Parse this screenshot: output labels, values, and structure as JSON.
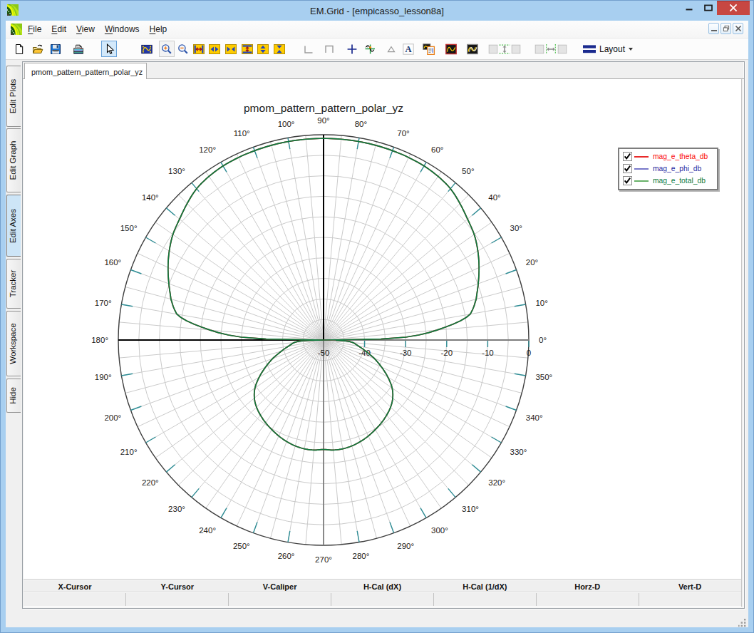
{
  "window": {
    "title": "EM.Grid - [empicasso_lesson8a]",
    "controls": [
      {
        "name": "minimize",
        "glyph": "minimize-icon"
      },
      {
        "name": "maximize",
        "glyph": "maximize-icon"
      },
      {
        "name": "close",
        "glyph": "close-icon"
      }
    ],
    "border_color": "#a8cff0",
    "close_color": "#c74742"
  },
  "menu": {
    "items": [
      {
        "label": "File",
        "mnemonic": "F"
      },
      {
        "label": "Edit",
        "mnemonic": "E"
      },
      {
        "label": "View",
        "mnemonic": "V"
      },
      {
        "label": "Windows",
        "mnemonic": "W"
      },
      {
        "label": "Help",
        "mnemonic": "H"
      }
    ],
    "mdi_controls": [
      "minimize",
      "restore",
      "close"
    ]
  },
  "toolbar": {
    "buttons": [
      {
        "icon": "new-document",
        "state": "normal"
      },
      {
        "icon": "open-file",
        "state": "normal"
      },
      {
        "icon": "save-file",
        "state": "normal"
      },
      {
        "icon": "print",
        "state": "normal"
      },
      {
        "icon": "pointer",
        "state": "selected"
      },
      {
        "icon": "fit-plot",
        "state": "normal"
      },
      {
        "icon": "zoom-in",
        "state": "raised"
      },
      {
        "icon": "zoom-out",
        "state": "normal"
      },
      {
        "icon": "expand-x",
        "state": "normal"
      },
      {
        "icon": "widen-x",
        "state": "normal"
      },
      {
        "icon": "narrow-x",
        "state": "normal"
      },
      {
        "icon": "expand-y",
        "state": "normal"
      },
      {
        "icon": "widen-y",
        "state": "normal"
      },
      {
        "icon": "narrow-y",
        "state": "normal"
      },
      {
        "icon": "axes-corner",
        "state": "disabled"
      },
      {
        "icon": "axes-box",
        "state": "disabled"
      },
      {
        "icon": "crosshair",
        "state": "normal"
      },
      {
        "icon": "tracker-cross",
        "state": "normal"
      },
      {
        "icon": "marker-triangle",
        "state": "disabled"
      },
      {
        "icon": "text-label",
        "state": "normal"
      },
      {
        "icon": "copy-graph",
        "state": "normal"
      },
      {
        "icon": "plot-single",
        "state": "normal"
      },
      {
        "icon": "plot-multi",
        "state": "normal"
      },
      {
        "icon": "blank-box-1",
        "state": "disabled"
      },
      {
        "icon": "equalize-vertical",
        "state": "disabled"
      },
      {
        "icon": "blank-box-2",
        "state": "disabled"
      },
      {
        "icon": "blank-box-3",
        "state": "disabled"
      },
      {
        "icon": "equalize-horizontal",
        "state": "disabled"
      },
      {
        "icon": "blank-box-4",
        "state": "disabled"
      }
    ],
    "layout_button": {
      "label": "Layout",
      "icon": "layout-bars-icon",
      "dropdown": true
    }
  },
  "side_tabs": {
    "items": [
      {
        "label": "Edit Plots",
        "selected": false
      },
      {
        "label": "Edit Graph",
        "selected": false
      },
      {
        "label": "Edit Axes",
        "selected": true
      },
      {
        "label": "Tracker",
        "selected": false
      },
      {
        "label": "Workspace",
        "selected": false
      },
      {
        "label": "Hide",
        "selected": false
      }
    ]
  },
  "doc_tab": {
    "label": "pmom_pattern_pattern_polar_yz",
    "selected": true
  },
  "tracker_bar": {
    "columns": [
      "X-Cursor",
      "Y-Cursor",
      "V-Caliper",
      "H-Cal (dX)",
      "H-Cal (1/dX)",
      "Horz-D",
      "Vert-D"
    ],
    "values": [
      "",
      "",
      "",
      "",
      "",
      "",
      ""
    ]
  },
  "chart_data": {
    "type": "line",
    "subtype": "polar",
    "title": "pmom_pattern_pattern_polar_yz",
    "angle_unit": "degrees",
    "angle_labels": [
      "0°",
      "10°",
      "20°",
      "30°",
      "40°",
      "50°",
      "60°",
      "70°",
      "80°",
      "90°",
      "100°",
      "110°",
      "120°",
      "130°",
      "140°",
      "150°",
      "160°",
      "170°",
      "180°",
      "190°",
      "200°",
      "210°",
      "220°",
      "230°",
      "240°",
      "250°",
      "260°",
      "270°",
      "280°",
      "290°",
      "300°",
      "310°",
      "320°",
      "330°",
      "340°",
      "350°"
    ],
    "angle_label_step_deg": 10,
    "spoke_step_deg": 5,
    "radial_axis": {
      "label_values": [
        -50,
        -40,
        -30,
        -20,
        -10,
        0
      ],
      "tick_labels": [
        "-50",
        "-40",
        "-30",
        "-20",
        "-10",
        "0"
      ],
      "min": -50,
      "max": 0,
      "ring_step_db": 5,
      "units": "dB"
    },
    "legend": {
      "position": "right",
      "entries": [
        {
          "label": "mag_e_theta_db",
          "color": "#e82a2a",
          "text_color": "#fb0a0a",
          "checked": true
        },
        {
          "label": "mag_e_phi_db",
          "color": "#7878c8",
          "text_color": "#2a2aa0",
          "checked": true
        },
        {
          "label": "mag_e_total_db",
          "color": "#67b168",
          "text_color": "#0e7a3e",
          "checked": true
        }
      ]
    },
    "series": [
      {
        "name": "mag_e_theta_db",
        "color": "#b22222",
        "points_deg_db": [
          [
            0,
            -50
          ],
          [
            1,
            -36
          ],
          [
            2,
            -30
          ],
          [
            3,
            -26.8
          ],
          [
            4,
            -24.3
          ],
          [
            5,
            -22.3
          ],
          [
            6,
            -20.2
          ],
          [
            7,
            -18.2
          ],
          [
            8,
            -16.3
          ],
          [
            9,
            -14.8
          ],
          [
            10,
            -13.7
          ],
          [
            12.5,
            -12.5
          ],
          [
            15,
            -11.5
          ],
          [
            20,
            -9.9
          ],
          [
            25,
            -8.2
          ],
          [
            30,
            -6.6
          ],
          [
            35,
            -5.2
          ],
          [
            40,
            -4.2
          ],
          [
            45,
            -3.0
          ],
          [
            50,
            -1.9
          ],
          [
            55,
            -1.35
          ],
          [
            60,
            -1.05
          ],
          [
            65,
            -0.95
          ],
          [
            70,
            -0.92
          ],
          [
            75,
            -0.9
          ],
          [
            80,
            -0.9
          ],
          [
            85,
            -0.9
          ],
          [
            90,
            -0.9
          ],
          [
            95,
            -0.9
          ],
          [
            100,
            -0.9
          ],
          [
            105,
            -0.9
          ],
          [
            110,
            -0.92
          ],
          [
            115,
            -0.95
          ],
          [
            120,
            -1.05
          ],
          [
            125,
            -1.35
          ],
          [
            130,
            -1.9
          ],
          [
            135,
            -3.0
          ],
          [
            140,
            -4.2
          ],
          [
            145,
            -5.2
          ],
          [
            150,
            -6.6
          ],
          [
            155,
            -8.2
          ],
          [
            160,
            -9.9
          ],
          [
            165,
            -11.5
          ],
          [
            167.5,
            -12.5
          ],
          [
            170,
            -13.7
          ],
          [
            171,
            -14.8
          ],
          [
            172,
            -16.3
          ],
          [
            173,
            -18.2
          ],
          [
            174,
            -20.2
          ],
          [
            175,
            -22.3
          ],
          [
            176,
            -24.3
          ],
          [
            177,
            -26.8
          ],
          [
            178,
            -30
          ],
          [
            179,
            -36
          ],
          [
            180,
            -50
          ],
          [
            181,
            -47
          ],
          [
            182,
            -45
          ],
          [
            183,
            -43.8
          ],
          [
            185,
            -42.8
          ],
          [
            187,
            -42.2
          ],
          [
            190,
            -41.3
          ],
          [
            193,
            -40.1
          ],
          [
            196,
            -38.8
          ],
          [
            200,
            -36.8
          ],
          [
            205,
            -34.4
          ],
          [
            210,
            -31.9
          ],
          [
            215,
            -29.6
          ],
          [
            220,
            -28.0
          ],
          [
            225,
            -26.9
          ],
          [
            230,
            -26.1
          ],
          [
            235,
            -25.4
          ],
          [
            240,
            -24.8
          ],
          [
            245,
            -24.2
          ],
          [
            250,
            -23.7
          ],
          [
            255,
            -23.3
          ],
          [
            260,
            -23.1
          ],
          [
            265,
            -23.1
          ],
          [
            270,
            -23.35
          ],
          [
            275,
            -23.1
          ],
          [
            280,
            -23.1
          ],
          [
            285,
            -23.3
          ],
          [
            290,
            -23.7
          ],
          [
            295,
            -24.2
          ],
          [
            300,
            -24.8
          ],
          [
            305,
            -25.4
          ],
          [
            310,
            -26.1
          ],
          [
            315,
            -26.9
          ],
          [
            320,
            -28.0
          ],
          [
            325,
            -29.6
          ],
          [
            330,
            -31.9
          ],
          [
            335,
            -34.4
          ],
          [
            340,
            -36.8
          ],
          [
            344,
            -38.8
          ],
          [
            347,
            -40.1
          ],
          [
            350,
            -41.3
          ],
          [
            353,
            -42.2
          ],
          [
            355,
            -42.8
          ],
          [
            357,
            -43.8
          ],
          [
            358,
            -45
          ],
          [
            359,
            -47
          ]
        ]
      },
      {
        "name": "mag_e_phi_db",
        "color": "#7878c8",
        "points_deg_db": [
          [
            0,
            -50
          ],
          [
            90,
            -50
          ],
          [
            180,
            -50
          ],
          [
            270,
            -50
          ],
          [
            360,
            -50
          ]
        ]
      },
      {
        "name": "mag_e_total_db",
        "color": "#0e7a3e",
        "points_deg_db": [
          [
            0,
            -50
          ],
          [
            1,
            -36
          ],
          [
            2,
            -30
          ],
          [
            3,
            -26.8
          ],
          [
            4,
            -24.3
          ],
          [
            5,
            -22.3
          ],
          [
            6,
            -20.2
          ],
          [
            7,
            -18.2
          ],
          [
            8,
            -16.3
          ],
          [
            9,
            -14.8
          ],
          [
            10,
            -13.7
          ],
          [
            12.5,
            -12.5
          ],
          [
            15,
            -11.5
          ],
          [
            20,
            -9.9
          ],
          [
            25,
            -8.2
          ],
          [
            30,
            -6.6
          ],
          [
            35,
            -5.2
          ],
          [
            40,
            -4.2
          ],
          [
            45,
            -3.0
          ],
          [
            50,
            -1.9
          ],
          [
            55,
            -1.35
          ],
          [
            60,
            -1.05
          ],
          [
            65,
            -0.95
          ],
          [
            70,
            -0.92
          ],
          [
            75,
            -0.9
          ],
          [
            80,
            -0.9
          ],
          [
            85,
            -0.9
          ],
          [
            90,
            -0.9
          ],
          [
            95,
            -0.9
          ],
          [
            100,
            -0.9
          ],
          [
            105,
            -0.9
          ],
          [
            110,
            -0.92
          ],
          [
            115,
            -0.95
          ],
          [
            120,
            -1.05
          ],
          [
            125,
            -1.35
          ],
          [
            130,
            -1.9
          ],
          [
            135,
            -3.0
          ],
          [
            140,
            -4.2
          ],
          [
            145,
            -5.2
          ],
          [
            150,
            -6.6
          ],
          [
            155,
            -8.2
          ],
          [
            160,
            -9.9
          ],
          [
            165,
            -11.5
          ],
          [
            167.5,
            -12.5
          ],
          [
            170,
            -13.7
          ],
          [
            171,
            -14.8
          ],
          [
            172,
            -16.3
          ],
          [
            173,
            -18.2
          ],
          [
            174,
            -20.2
          ],
          [
            175,
            -22.3
          ],
          [
            176,
            -24.3
          ],
          [
            177,
            -26.8
          ],
          [
            178,
            -30
          ],
          [
            179,
            -36
          ],
          [
            180,
            -50
          ],
          [
            181,
            -47
          ],
          [
            182,
            -45
          ],
          [
            183,
            -43.8
          ],
          [
            185,
            -42.8
          ],
          [
            187,
            -42.2
          ],
          [
            190,
            -41.3
          ],
          [
            193,
            -40.1
          ],
          [
            196,
            -38.8
          ],
          [
            200,
            -36.8
          ],
          [
            205,
            -34.4
          ],
          [
            210,
            -31.9
          ],
          [
            215,
            -29.6
          ],
          [
            220,
            -28.0
          ],
          [
            225,
            -26.9
          ],
          [
            230,
            -26.1
          ],
          [
            235,
            -25.4
          ],
          [
            240,
            -24.8
          ],
          [
            245,
            -24.2
          ],
          [
            250,
            -23.7
          ],
          [
            255,
            -23.3
          ],
          [
            260,
            -23.1
          ],
          [
            265,
            -23.1
          ],
          [
            270,
            -23.35
          ],
          [
            275,
            -23.1
          ],
          [
            280,
            -23.1
          ],
          [
            285,
            -23.3
          ],
          [
            290,
            -23.7
          ],
          [
            295,
            -24.2
          ],
          [
            300,
            -24.8
          ],
          [
            305,
            -25.4
          ],
          [
            310,
            -26.1
          ],
          [
            315,
            -26.9
          ],
          [
            320,
            -28.0
          ],
          [
            325,
            -29.6
          ],
          [
            330,
            -31.9
          ],
          [
            335,
            -34.4
          ],
          [
            340,
            -36.8
          ],
          [
            344,
            -38.8
          ],
          [
            347,
            -40.1
          ],
          [
            350,
            -41.3
          ],
          [
            353,
            -42.2
          ],
          [
            355,
            -42.8
          ],
          [
            357,
            -43.8
          ],
          [
            358,
            -45
          ],
          [
            359,
            -47
          ]
        ]
      }
    ],
    "grid": {
      "ring_color": "#cacaca",
      "spoke_color": "#cacaca",
      "outer_ring_color": "#3e3e3e",
      "tick_color": "#2f8e96",
      "axis_up_left_color": "#000000",
      "axis_right_down_color": "#7d7d7d"
    }
  },
  "status_bar": {
    "text": ""
  }
}
